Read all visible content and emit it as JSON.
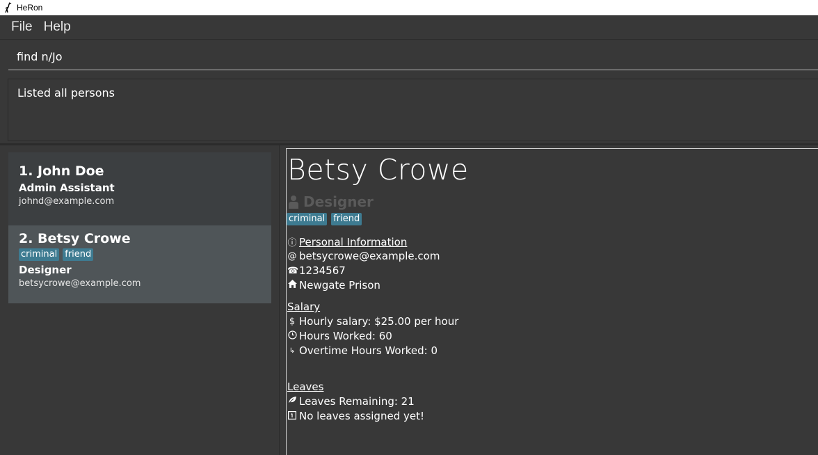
{
  "window": {
    "title": "HeRon"
  },
  "menu": {
    "file": "File",
    "help": "Help"
  },
  "command": {
    "value": "find n/Jo"
  },
  "result": {
    "text": "Listed all persons"
  },
  "persons": [
    {
      "name": "1.  John Doe",
      "role": "Admin Assistant",
      "email": "johnd@example.com",
      "tags": []
    },
    {
      "name": "2.  Betsy Crowe",
      "role": "Designer",
      "email": "betsycrowe@example.com",
      "tags": [
        "criminal",
        "friend"
      ]
    }
  ],
  "detail": {
    "name": "Betsy Crowe",
    "role": "Designer",
    "tags": [
      "criminal",
      "friend"
    ],
    "personal_title": "Personal Information",
    "email": "betsycrowe@example.com",
    "phone": "1234567",
    "address": "Newgate Prison",
    "salary_title": "Salary",
    "hourly_salary": "Hourly salary: $25.00 per hour",
    "hours_worked": "Hours Worked: 60",
    "overtime": "Overtime Hours Worked: 0",
    "leaves_title": "Leaves",
    "leaves_remaining": "Leaves Remaining: 21",
    "leaves_assigned": "No leaves assigned yet!"
  },
  "colors": {
    "tag": "#3e7b91",
    "selected_card": "#4f5558",
    "background": "#383838"
  }
}
